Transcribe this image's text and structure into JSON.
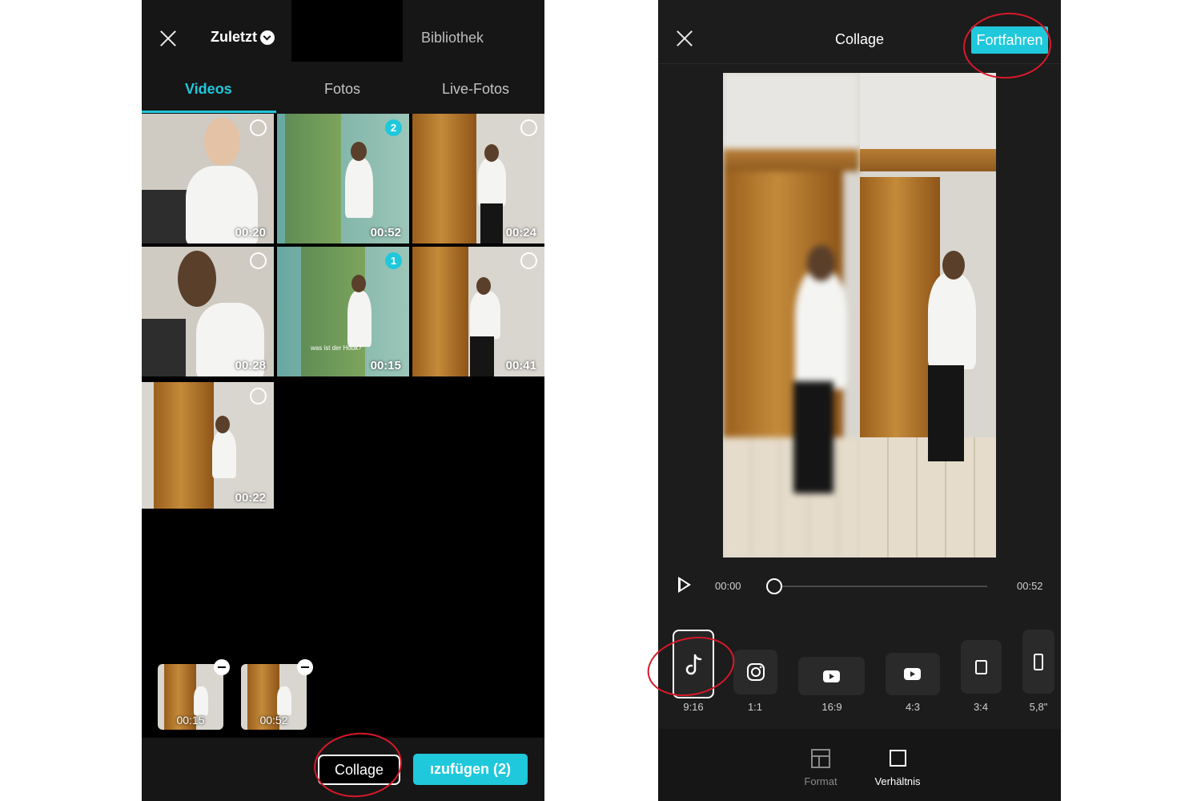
{
  "left": {
    "album_label": "Zuletzt",
    "library_label": "Bibliothek",
    "tabs": [
      {
        "label": "Videos",
        "active": true
      },
      {
        "label": "Fotos",
        "active": false
      },
      {
        "label": "Live-Fotos",
        "active": false
      }
    ],
    "grid": [
      {
        "duration": "00:20",
        "selection": ""
      },
      {
        "duration": "00:52",
        "selection": "2"
      },
      {
        "duration": "00:24",
        "selection": ""
      },
      {
        "duration": "00:28",
        "selection": ""
      },
      {
        "duration": "00:15",
        "selection": "1",
        "caption": "was ist der Hook?"
      },
      {
        "duration": "00:41",
        "selection": ""
      },
      {
        "duration": "00:22",
        "selection": ""
      }
    ],
    "tray": [
      {
        "duration": "00:15"
      },
      {
        "duration": "00:52"
      }
    ],
    "collage_button": "Collage",
    "add_button": "ızufügen (2)"
  },
  "right": {
    "title": "Collage",
    "continue_button": "Fortfahren",
    "time_current": "00:00",
    "time_total": "00:52",
    "playhead_fraction": 0,
    "ratios": [
      {
        "label": "9:16",
        "icon": "tiktok-icon",
        "active": true
      },
      {
        "label": "1:1",
        "icon": "instagram-icon",
        "active": false
      },
      {
        "label": "16:9",
        "icon": "youtube-icon",
        "active": false
      },
      {
        "label": "4:3",
        "icon": "youtube-icon",
        "active": false
      },
      {
        "label": "3:4",
        "icon": "portrait-rect-icon",
        "active": false
      },
      {
        "label": "5,8\"",
        "icon": "phone-rect-icon",
        "active": false
      }
    ],
    "bottom_tabs": [
      {
        "label": "Format",
        "icon": "layout-grid-icon",
        "active": false
      },
      {
        "label": "Verhältnis",
        "icon": "square-icon",
        "active": true
      }
    ]
  },
  "colors": {
    "accent": "#1fc8db",
    "annotation": "#d8192a",
    "dark_bg": "#161616"
  }
}
